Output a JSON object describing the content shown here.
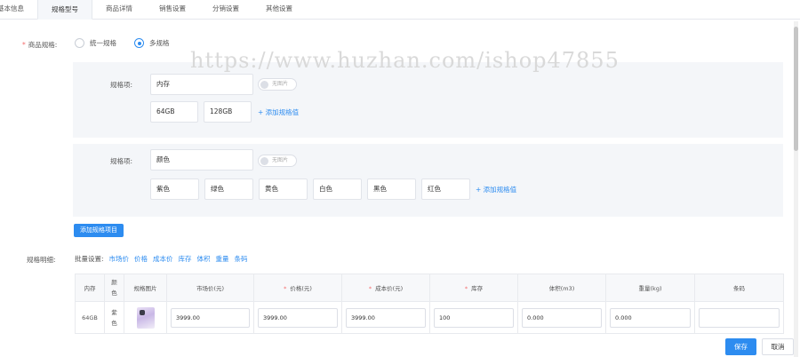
{
  "tabs": [
    "基本信息",
    "规格型号",
    "商品详情",
    "销售设置",
    "分销设置",
    "其他设置"
  ],
  "watermark": "https://www.huzhan.com/ishop47855",
  "spec_mode": {
    "label": "商品规格:",
    "required_mark": "*",
    "option_single": "统一规格",
    "option_multi": "多规格",
    "selected": "多规格"
  },
  "groups": [
    {
      "label": "规格项:",
      "name": "内存",
      "image_toggle": "无图片",
      "values": [
        "64GB",
        "128GB"
      ],
      "add_value": "+ 添加规格值"
    },
    {
      "label": "规格项:",
      "name": "颜色",
      "image_toggle": "无图片",
      "values": [
        "紫色",
        "绿色",
        "黄色",
        "白色",
        "黑色",
        "红色"
      ],
      "add_value": "+ 添加规格值"
    }
  ],
  "add_spec_button": "添加规格项目",
  "detail": {
    "label": "规格明细:",
    "batch_label": "批量设置:",
    "batch_links": [
      "市场价",
      "价格",
      "成本价",
      "库存",
      "体积",
      "重量",
      "条码"
    ],
    "columns": [
      "内存",
      "颜色",
      "规格图片",
      "市场价(元)",
      "价格(元)",
      "成本价(元)",
      "库存",
      "体积(m3)",
      "重量(kg)",
      "条码"
    ],
    "required_columns": [
      false,
      false,
      false,
      false,
      true,
      true,
      true,
      false,
      false,
      false
    ],
    "rows": [
      {
        "memory": "64GB",
        "color": "紫色",
        "image": "purple-phone-thumbnail",
        "market_price": "3999.00",
        "price": "3999.00",
        "cost": "3999.00",
        "stock": "100",
        "volume": "0.000",
        "weight": "0.000",
        "barcode": ""
      }
    ]
  },
  "footer": {
    "save": "保存",
    "cancel": "取消"
  },
  "colors": {
    "accent": "#2d8cf0",
    "required": "#f56c6c",
    "group_bg": "#f4f6f9"
  }
}
